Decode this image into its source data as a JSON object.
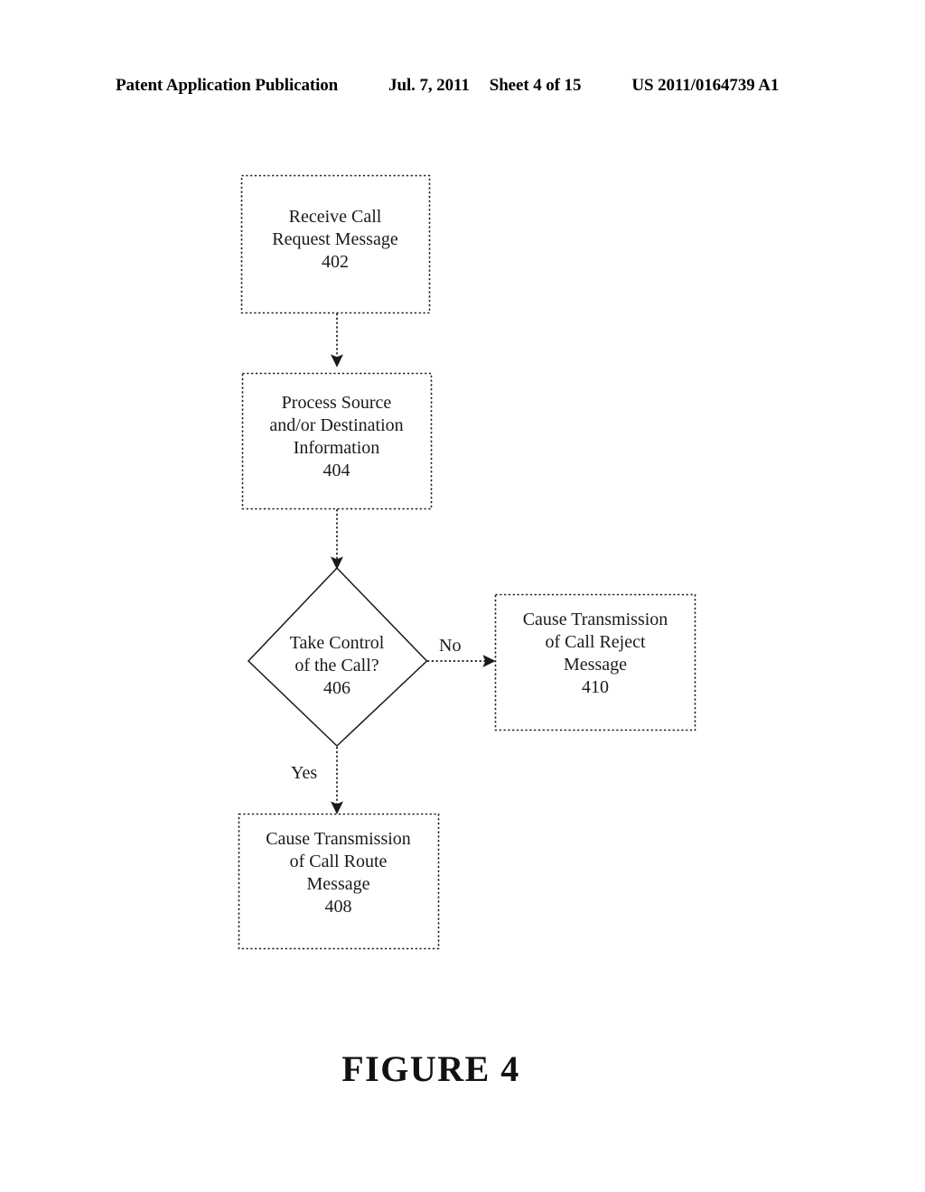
{
  "header": {
    "publication": "Patent Application Publication",
    "date": "Jul. 7, 2011",
    "sheet": "Sheet 4 of 15",
    "patent_number": "US 2011/0164739 A1"
  },
  "figure": {
    "caption": "FIGURE 4",
    "stroke_color": "#1a1a1a",
    "background_color": "#ffffff"
  },
  "diagram": {
    "type": "flowchart",
    "nodes": [
      {
        "id": "402",
        "shape": "rectangle",
        "border": "dotted",
        "text": "Receive Call\nRequest Message\n402",
        "label": "Receive Call Request Message",
        "ref": "402"
      },
      {
        "id": "404",
        "shape": "rectangle",
        "border": "dotted",
        "text": "Process Source\nand/or Destination\nInformation\n404",
        "label": "Process Source and/or Destination Information",
        "ref": "404"
      },
      {
        "id": "406",
        "shape": "diamond",
        "border": "solid",
        "text": "Take Control\nof the Call?\n406",
        "label": "Take Control of the Call?",
        "ref": "406"
      },
      {
        "id": "408",
        "shape": "rectangle",
        "border": "dotted",
        "text": "Cause Transmission\nof Call Route\nMessage\n408",
        "label": "Cause Transmission of Call Route Message",
        "ref": "408"
      },
      {
        "id": "410",
        "shape": "rectangle",
        "border": "dotted",
        "text": "Cause Transmission\nof Call Reject\nMessage\n410",
        "label": "Cause Transmission of Call Reject Message",
        "ref": "410"
      }
    ],
    "edges": [
      {
        "from": "402",
        "to": "404",
        "label": "",
        "style": "dotted",
        "direction": "down"
      },
      {
        "from": "404",
        "to": "406",
        "label": "",
        "style": "dotted",
        "direction": "down"
      },
      {
        "from": "406",
        "to": "410",
        "label": "No",
        "style": "dotted",
        "direction": "right"
      },
      {
        "from": "406",
        "to": "408",
        "label": "Yes",
        "style": "dotted",
        "direction": "down"
      }
    ]
  }
}
